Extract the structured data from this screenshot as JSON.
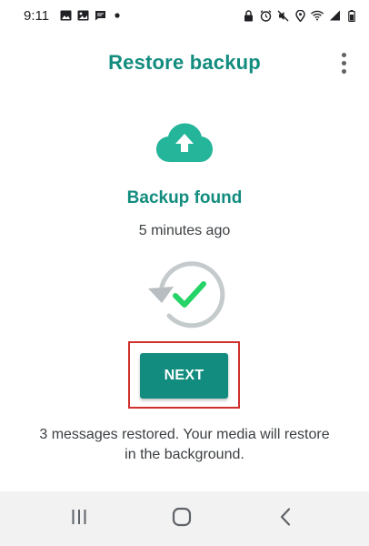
{
  "status_bar": {
    "time": "9:11",
    "left_icons": [
      "gallery-icon",
      "photo-icon",
      "message-icon",
      "dot-icon"
    ],
    "right_icons": [
      "lock-icon",
      "alarm-icon",
      "mute-icon",
      "location-icon",
      "wifi-icon",
      "signal-icon",
      "battery-icon"
    ]
  },
  "app_bar": {
    "title": "Restore backup",
    "menu_icon": "more-vert-icon"
  },
  "backup": {
    "icon": "cloud-upload-icon",
    "title": "Backup found",
    "time": "5 minutes ago",
    "status_icon": "restore-check-icon"
  },
  "actions": {
    "next_label": "NEXT"
  },
  "message": "3 messages restored. Your media will restore in the background.",
  "nav_bar": {
    "items": [
      "recents-icon",
      "home-icon",
      "back-icon"
    ]
  },
  "colors": {
    "brand": "#128c7e",
    "cloud": "#25b59a",
    "check": "#25d366",
    "highlight": "#d0312d"
  }
}
